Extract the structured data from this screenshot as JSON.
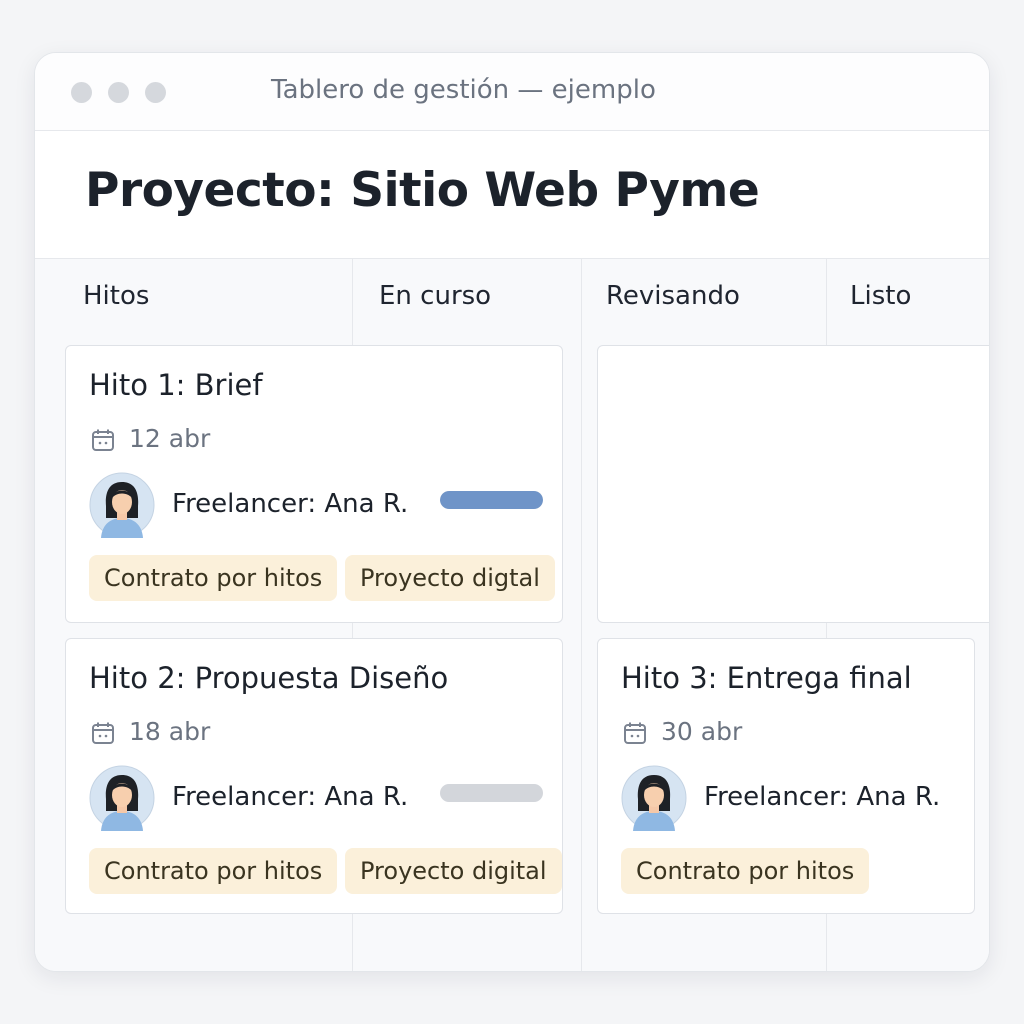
{
  "window": {
    "title": "Tablero de gestión — ejemplo"
  },
  "header": {
    "title": "Proyecto: Sitio Web Pyme"
  },
  "columns": [
    {
      "label": "Hitos"
    },
    {
      "label": "En curso"
    },
    {
      "label": "Revisando"
    },
    {
      "label": "Listo"
    }
  ],
  "cards": [
    {
      "title": "Hito 1: Brief",
      "date": "12 abr",
      "freelancer": "Freelancer: Ana R.",
      "progress": 1.0,
      "tags": [
        "Contrato por hitos",
        "Proyecto digtal"
      ]
    },
    {
      "title": "Hito 2: Propuesta Diseño",
      "date": "18 abr",
      "freelancer": "Freelancer: Ana R.",
      "progress": 0.0,
      "tags": [
        "Contrato por hitos",
        "Proyecto digital"
      ]
    },
    {
      "title": "Hito 3: Entrega final",
      "date": "30 abr",
      "freelancer": "Freelancer: Ana R.",
      "tags": [
        "Contrato por hitos"
      ]
    }
  ],
  "colors": {
    "accent": "#6f94c8",
    "tag_bg": "#fbf0da",
    "progress_track": "#d3d6db"
  },
  "icons": {
    "window_controls": [
      "circle-icon",
      "circle-icon",
      "circle-icon"
    ],
    "date": "calendar-icon",
    "avatar": "user-avatar-icon"
  }
}
